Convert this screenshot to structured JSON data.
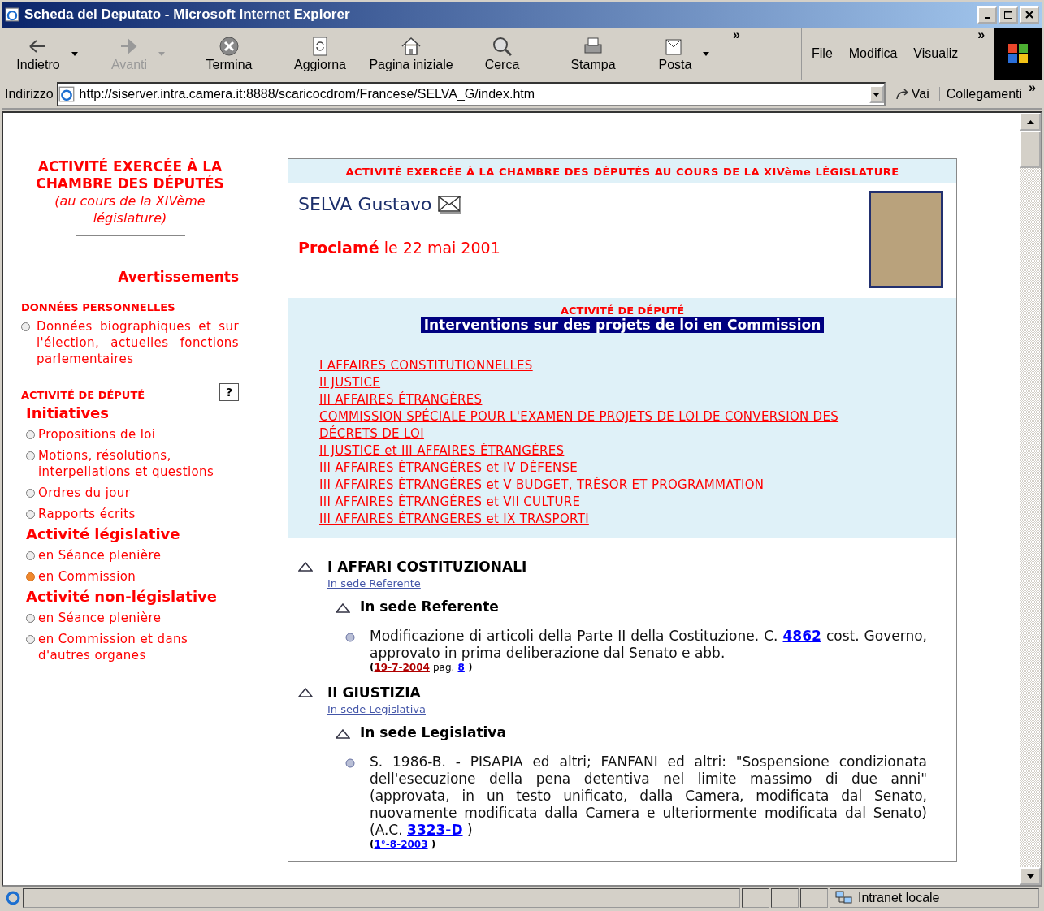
{
  "window": {
    "title": "Scheda del Deputato - Microsoft Internet Explorer"
  },
  "toolbar": {
    "buttons": [
      {
        "label": "Indietro",
        "disabled": false,
        "dropdown": true
      },
      {
        "label": "Avanti",
        "disabled": true,
        "dropdown": true
      },
      {
        "label": "Termina",
        "disabled": false,
        "dropdown": false
      },
      {
        "label": "Aggiorna",
        "disabled": false,
        "dropdown": false
      },
      {
        "label": "Pagina iniziale",
        "disabled": false,
        "dropdown": false
      },
      {
        "label": "Cerca",
        "disabled": false,
        "dropdown": false
      },
      {
        "label": "Stampa",
        "disabled": false,
        "dropdown": false
      },
      {
        "label": "Posta",
        "disabled": false,
        "dropdown": true
      }
    ],
    "more": "»",
    "menu": [
      "File",
      "Modifica",
      "Visualiz"
    ],
    "menu_more": "»"
  },
  "address": {
    "label": "Indirizzo",
    "value": "http://siserver.intra.camera.it:8888/scaricocdrom/Francese/SELVA_G/index.htm",
    "go": "Vai",
    "links": "Collegamenti",
    "links_more": "»"
  },
  "sidebar": {
    "title": "ACTIVITÉ EXERCÉE À LA CHAMBRE DES DÉPUTÉS",
    "subtitle": "(au cours de la XIVème législature)",
    "warnings": "Avertissements",
    "personal": {
      "heading": "DONNÉES PERSONNELLES",
      "items": [
        {
          "label": "Données biographiques et sur l'élection, actuelles fonctions parlementaires",
          "selected": false
        }
      ]
    },
    "activity": {
      "heading": "ACTIVITÉ DE DÉPUTÉ",
      "help": "?",
      "groups": [
        {
          "title": "Initiatives",
          "items": [
            {
              "label": "Propositions de loi",
              "selected": false
            },
            {
              "label": "Motions, résolutions, interpellations et questions",
              "selected": false
            },
            {
              "label": "Ordres du jour",
              "selected": false
            },
            {
              "label": "Rapports écrits",
              "selected": false
            }
          ]
        },
        {
          "title": "Activité législative",
          "items": [
            {
              "label": "en Séance plenière",
              "selected": false
            },
            {
              "label": "en Commission",
              "selected": true
            }
          ]
        },
        {
          "title": "Activité non-législative",
          "items": [
            {
              "label": "en Séance plenière",
              "selected": false
            },
            {
              "label": "en Commission et dans d'autres organes",
              "selected": false
            }
          ]
        }
      ]
    }
  },
  "main": {
    "banner": "ACTIVITÉ EXERCÉE À LA CHAMBRE DES DÉPUTÉS AU COURS DE LA XIVème LÉGISLATURE",
    "name": "SELVA Gustavo",
    "proclaimed": "**Proclamé** le 22 mai 2001",
    "activity_heading": "ACTIVITÉ DE DÉPUTÉ",
    "section_title": "Interventions sur des projets de loi en Commission",
    "commission_links": [
      "I AFFAIRES CONSTITUTIONNELLES",
      "II JUSTICE",
      "III AFFAIRES ÉTRANGÈRES",
      "COMMISSION SPÉCIALE POUR L'EXAMEN DE PROJETS DE LOI DE CONVERSION DES DÉCRETS DE LOI",
      "II JUSTICE et III AFFAIRES ÉTRANGÈRES",
      "III AFFAIRES ÉTRANGÈRES et IV DÉFENSE",
      "III AFFAIRES ÉTRANGÈRES et V BUDGET, TRÉSOR ET PROGRAMMATION",
      "III AFFAIRES ÉTRANGÈRES et VII CULTURE",
      "III AFFAIRES ÉTRANGÈRES et IX TRASPORTI"
    ],
    "committees": [
      {
        "title": "I AFFARI COSTITUZIONALI",
        "sub_link": "In sede Referente",
        "sedi": [
          {
            "title": "In sede Referente",
            "items": [
              {
                "before": "Modificazione di articoli della Parte II della Costituzione. C.",
                "link": "4862",
                "after": "cost. Governo, approvato in prima deliberazione dal Senato e abb.",
                "ref_open": "(",
                "date": "19-7-2004",
                "visited": true,
                "page_label": "pag.",
                "page": "8",
                "ref_close": ")"
              }
            ]
          }
        ]
      },
      {
        "title": "II GIUSTIZIA",
        "sub_link": "In sede Legislativa",
        "sedi": [
          {
            "title": "In sede Legislativa",
            "items": [
              {
                "before": "S. 1986-B. - PISAPIA ed altri; FANFANI ed altri: \"Sospensione condizionata dell'esecuzione della pena detentiva nel limite massimo di due anni\" (approvata, in un testo unificato, dalla Camera, modificata dal Senato, nuovamente modificata dalla Camera e ulteriormente modificata dal Senato) (A.C.",
                "link": "3323-D",
                "after": ")",
                "ref_open": "(",
                "date": "1°-8-2003",
                "visited": false,
                "ref_close": ")"
              }
            ]
          }
        ]
      }
    ]
  },
  "status_bar": {
    "zone": "Intranet locale"
  }
}
